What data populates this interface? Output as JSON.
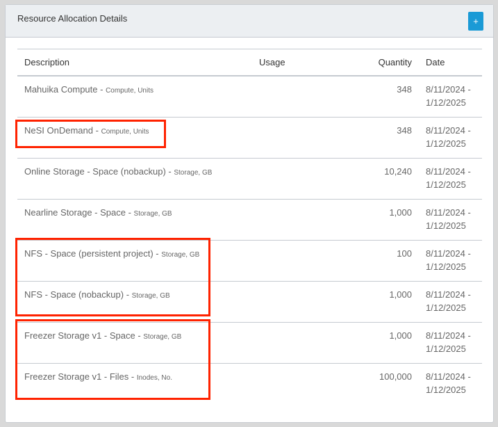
{
  "panel": {
    "title": "Resource Allocation Details",
    "add_label": "+"
  },
  "columns": [
    "Description",
    "Usage",
    "Quantity",
    "Date"
  ],
  "rows": [
    {
      "name": "Mahuika Compute",
      "sep": " - ",
      "unit": "Compute, Units",
      "usage": "",
      "quantity": "348",
      "date_start": "8/11/2024 -",
      "date_end": "1/12/2025"
    },
    {
      "name": "NeSI OnDemand",
      "sep": " - ",
      "unit": "Compute, Units",
      "usage": "",
      "quantity": "348",
      "date_start": "8/11/2024 -",
      "date_end": "1/12/2025"
    },
    {
      "name": "Online Storage - Space (nobackup)",
      "sep": " - ",
      "unit": "Storage, GB",
      "usage": "",
      "quantity": "10,240",
      "date_start": "8/11/2024 -",
      "date_end": "1/12/2025"
    },
    {
      "name": "Nearline Storage - Space",
      "sep": " - ",
      "unit": "Storage, GB",
      "usage": "",
      "quantity": "1,000",
      "date_start": "8/11/2024 -",
      "date_end": "1/12/2025"
    },
    {
      "name": "NFS - Space (persistent project)",
      "sep": " - ",
      "unit": "Storage, GB",
      "usage": "",
      "quantity": "100",
      "date_start": "8/11/2024 -",
      "date_end": "1/12/2025"
    },
    {
      "name": "NFS - Space (nobackup)",
      "sep": " - ",
      "unit": "Storage, GB",
      "usage": "",
      "quantity": "1,000",
      "date_start": "8/11/2024 -",
      "date_end": "1/12/2025"
    },
    {
      "name": "Freezer Storage v1 - Space",
      "sep": " - ",
      "unit": "Storage, GB",
      "usage": "",
      "quantity": "1,000",
      "date_start": "8/11/2024 -",
      "date_end": "1/12/2025"
    },
    {
      "name": "Freezer Storage v1 - Files",
      "sep": " - ",
      "unit": "Inodes, No.",
      "usage": "",
      "quantity": "100,000",
      "date_start": "8/11/2024 -",
      "date_end": "1/12/2025"
    }
  ],
  "highlight_color": "#ff2200"
}
